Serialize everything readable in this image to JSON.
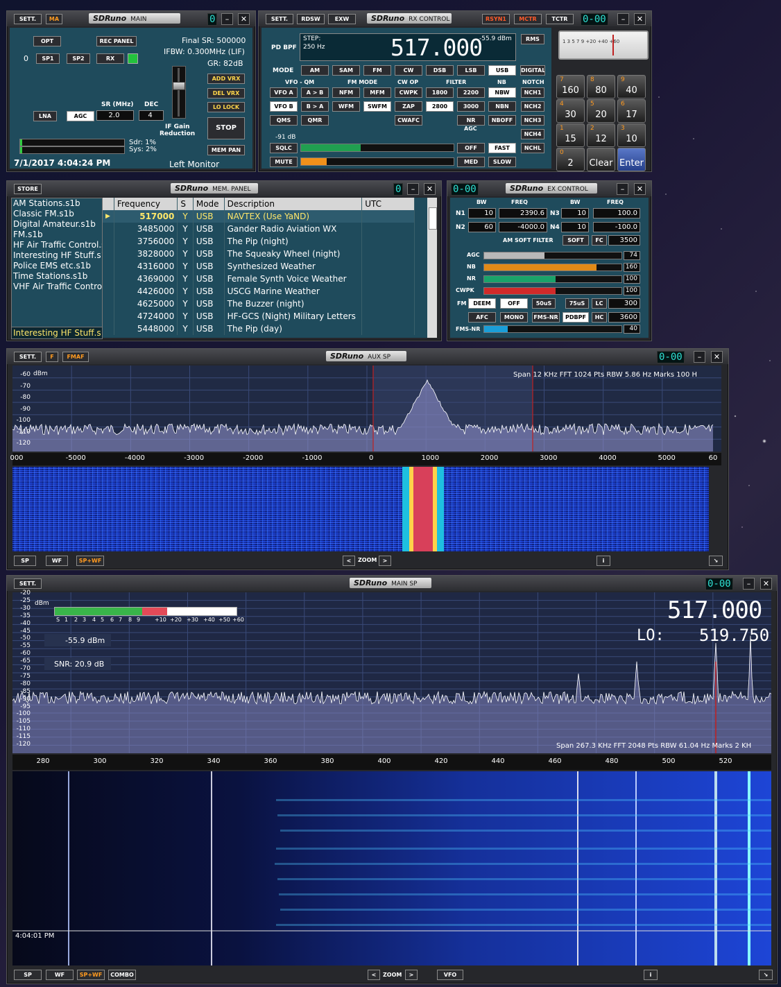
{
  "main": {
    "sett": "SETT.",
    "ma": "MA",
    "logo": "SDRuno",
    "title": "MAIN",
    "led": "0",
    "opt": "OPT",
    "rec_panel": "REC PANEL",
    "zero": "0",
    "sp1": "SP1",
    "sp2": "SP2",
    "rx": "RX",
    "final_sr": "Final SR: 500000",
    "ifbw": "IFBW: 0.300MHz (LIF)",
    "gr": "GR: 82dB",
    "add_vrx": "ADD VRX",
    "del_vrx": "DEL VRX",
    "lo_lock": "LO LOCK",
    "stop": "STOP",
    "mem_pan": "MEM PAN",
    "sr_label": "SR (MHz)",
    "dec_label": "DEC",
    "sr_value": "2.0",
    "dec_value": "4",
    "lna": "LNA",
    "agc": "AGC",
    "if_gain": "IF Gain",
    "reduction": "Reduction",
    "sdr": "Sdr: 1%",
    "sys": "Sys: 2%",
    "datetime": "7/1/2017 4:04:24 PM",
    "monitor": "Left Monitor"
  },
  "rx": {
    "sett": "SETT.",
    "rdsw": "RDSW",
    "exw": "EXW",
    "logo": "SDRuno",
    "title": "RX CONTROL",
    "rsyn1": "RSYN1",
    "mctr": "MCTR",
    "tctr": "TCTR",
    "led": "0-00",
    "pdbpf": "PD BPF",
    "step_label": "STEP:",
    "step_value": "250 Hz",
    "freq": "517.000",
    "dbm": "-55.9 dBm",
    "rms": "RMS",
    "mode_label": "MODE",
    "modes": [
      "AM",
      "SAM",
      "FM",
      "CW",
      "DSB",
      "LSB",
      "USB",
      "DIGITAL"
    ],
    "vfo_qm": "VFO - QM",
    "fm_mode": "FM MODE",
    "cw_op": "CW OP",
    "filter": "FILTER",
    "nb": "NB",
    "notch": "NOTCH",
    "vfoa": "VFO A",
    "atob": "A > B",
    "nfm": "NFM",
    "mfm": "MFM",
    "cwpk": "CWPK",
    "f1800": "1800",
    "f2200": "2200",
    "nbw": "NBW",
    "nch1": "NCH1",
    "vfob": "VFO B",
    "btoa": "B > A",
    "wfm": "WFM",
    "swfm": "SWFM",
    "zap": "ZAP",
    "f2800": "2800",
    "f3000": "3000",
    "nbn": "NBN",
    "nch2": "NCH2",
    "qms": "QMS",
    "qmr": "QMR",
    "cwafc": "CWAFC",
    "nr": "NR",
    "nboff": "NBOFF",
    "nch3": "NCH3",
    "sq_db": "-91 dB",
    "agc_label": "AGC",
    "nch4": "NCH4",
    "sqlc": "SQLC",
    "off": "OFF",
    "fast": "FAST",
    "nchl": "NCHL",
    "mute": "MUTE",
    "med": "MED",
    "slow": "SLOW",
    "sqlc_level": 0.39,
    "mute_level": 0.17,
    "meter_scale": "1 3 5 7 9  +20 +40 +60",
    "keys": [
      {
        "s": "7",
        "m": "160"
      },
      {
        "s": "8",
        "m": "80"
      },
      {
        "s": "9",
        "m": "40"
      },
      {
        "s": "4",
        "m": "30"
      },
      {
        "s": "5",
        "m": "20"
      },
      {
        "s": "6",
        "m": "17"
      },
      {
        "s": "1",
        "m": "15"
      },
      {
        "s": "2",
        "m": "12"
      },
      {
        "s": "3",
        "m": "10"
      },
      {
        "s": "0",
        "m": "2"
      },
      {
        "s": "",
        "m": "Clear"
      },
      {
        "s": "",
        "m": "Enter"
      }
    ]
  },
  "mem": {
    "store": "STORE",
    "logo": "SDRuno",
    "title": "MEM. PANEL",
    "led": "0",
    "files": [
      "AM Stations.s1b",
      "Classic FM.s1b",
      "Digital Amateur.s1b",
      "FM.s1b",
      "HF Air Traffic Control.s",
      "Interesting HF Stuff.s1",
      "Police EMS etc.s1b",
      "Time Stations.s1b",
      "VHF Air Traffic Contro"
    ],
    "file_selected": "Interesting HF Stuff.s",
    "headers": [
      "Frequency",
      "S",
      "Mode",
      "Description",
      "UTC"
    ],
    "rows": [
      [
        "517000",
        "Y",
        "USB",
        "NAVTEX (Use YaND)",
        ""
      ],
      [
        "3485000",
        "Y",
        "USB",
        "Gander Radio Aviation WX",
        ""
      ],
      [
        "3756000",
        "Y",
        "USB",
        "The Pip (night)",
        ""
      ],
      [
        "3828000",
        "Y",
        "USB",
        "The Squeaky Wheel (night)",
        ""
      ],
      [
        "4316000",
        "Y",
        "USB",
        "Synthesized Weather",
        ""
      ],
      [
        "4369000",
        "Y",
        "USB",
        "Female Synth Voice Weather",
        ""
      ],
      [
        "4426000",
        "Y",
        "USB",
        "USCG Marine Weather",
        ""
      ],
      [
        "4625000",
        "Y",
        "USB",
        "The Buzzer (night)",
        ""
      ],
      [
        "4724000",
        "Y",
        "USB",
        "HF-GCS (Night) Military Letters",
        ""
      ],
      [
        "5448000",
        "Y",
        "USB",
        "The Pip (day)",
        ""
      ]
    ]
  },
  "ex": {
    "led": "0-00",
    "logo": "SDRuno",
    "title": "EX CONTROL",
    "bw": "BW",
    "freq": "FREQ",
    "n1": "N1",
    "n1_bw": "10",
    "n1_freq": "2390.6",
    "n3": "N3",
    "n3_bw": "10",
    "n3_freq": "100.0",
    "n2": "N2",
    "n2_bw": "60",
    "n2_freq": "-4000.0",
    "n4": "N4",
    "n4_bw": "10",
    "n4_freq": "-100.0",
    "am_soft": "AM SOFT FILTER",
    "soft": "SOFT",
    "fc": "FC",
    "fc_val": "3500",
    "sliders": [
      {
        "label": "AGC",
        "value": "74",
        "level": 0.44,
        "color": "#b9b9b9"
      },
      {
        "label": "NB",
        "value": "160",
        "level": 0.82,
        "color": "#e08a18"
      },
      {
        "label": "NR",
        "value": "100",
        "level": 0.52,
        "color": "#1aa36a"
      },
      {
        "label": "CWPK",
        "value": "100",
        "level": 0.52,
        "color": "#d12a2a"
      }
    ],
    "fm": "FM",
    "deem": "DEEM",
    "off": "OFF",
    "us50": "50uS",
    "us75": "75uS",
    "lc": "LC",
    "lc_val": "300",
    "afc": "AFC",
    "mono": "MONO",
    "fmsnr": "FMS-NR",
    "pdbpf": "PDBPF",
    "hc": "HC",
    "hc_val": "3600",
    "fmsnr_label": "FMS-NR",
    "fmsnr_val": "40",
    "fmsnr_level": 0.17
  },
  "aux": {
    "sett": "SETT.",
    "f": "F",
    "fmaf": "FMAF",
    "logo": "SDRuno",
    "title": "AUX SP",
    "led": "0-00",
    "dbm": "dBm",
    "info": "Span 12 KHz  FFT 1024 Pts  RBW 5.86 Hz  Marks 100 H",
    "y_ticks": [
      "-60",
      "-70",
      "-80",
      "-90",
      "-100",
      "-110",
      "-120"
    ],
    "x_ticks": [
      "000",
      "-5000",
      "-4000",
      "-3000",
      "-2000",
      "-1000",
      "0",
      "1000",
      "2000",
      "3000",
      "4000",
      "5000",
      "60"
    ],
    "sp": "SP",
    "wf": "WF",
    "spwf": "SP+WF",
    "zoom": "ZOOM",
    "i": "i"
  },
  "mainsp": {
    "sett": "SETT.",
    "logo": "SDRuno",
    "title": "MAIN SP",
    "led": "0-00",
    "dbm": "dBm",
    "freq": "517.000",
    "lo_label": "LO:",
    "lo_value": "519.750",
    "level": "-55.9 dBm",
    "snr": "SNR: 20.9 dB",
    "smeter": [
      "S",
      "1",
      "2",
      "3",
      "4",
      "5",
      "6",
      "7",
      "8",
      "9",
      "+10",
      "+20",
      "+30",
      "+40",
      "+50",
      "+60"
    ],
    "y_ticks": [
      "-20",
      "-25",
      "-30",
      "-35",
      "-40",
      "-45",
      "-50",
      "-55",
      "-60",
      "-65",
      "-70",
      "-75",
      "-80",
      "-85",
      "-90",
      "-95",
      "-100",
      "-105",
      "-110",
      "-115",
      "-120"
    ],
    "x_ticks": [
      "280",
      "300",
      "320",
      "340",
      "360",
      "380",
      "400",
      "420",
      "440",
      "460",
      "480",
      "500",
      "520"
    ],
    "info": "Span 267.3 KHz  FFT 2048 Pts  RBW 61.04 Hz  Marks 2 KH",
    "wf_time": "4:04:01 PM",
    "sp": "SP",
    "wf": "WF",
    "spwf": "SP+WF",
    "combo": "COMBO",
    "zoom": "ZOOM",
    "vfo": "VFO",
    "i": "i"
  }
}
